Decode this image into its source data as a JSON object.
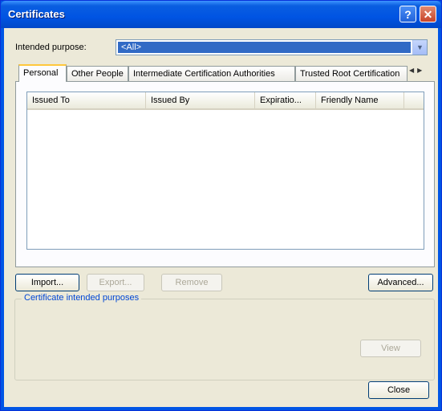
{
  "window": {
    "title": "Certificates"
  },
  "purpose": {
    "label": "Intended purpose:",
    "value": "<All>"
  },
  "tabs": [
    {
      "label": "Personal"
    },
    {
      "label": "Other People"
    },
    {
      "label": "Intermediate Certification Authorities"
    },
    {
      "label": "Trusted Root Certification"
    }
  ],
  "columns": [
    "Issued To",
    "Issued By",
    "Expiratio...",
    "Friendly Name"
  ],
  "buttons": {
    "import": "Import...",
    "export": "Export...",
    "remove": "Remove",
    "advanced": "Advanced...",
    "view": "View",
    "close": "Close"
  },
  "group": {
    "label": "Certificate intended purposes"
  },
  "icons": {
    "help": "help-icon",
    "close": "close-icon",
    "dropdown": "chevron-down-icon"
  },
  "colors": {
    "titlebar": "#0054e3",
    "selection": "#316ac5",
    "tab_highlight": "#ffc83c"
  }
}
